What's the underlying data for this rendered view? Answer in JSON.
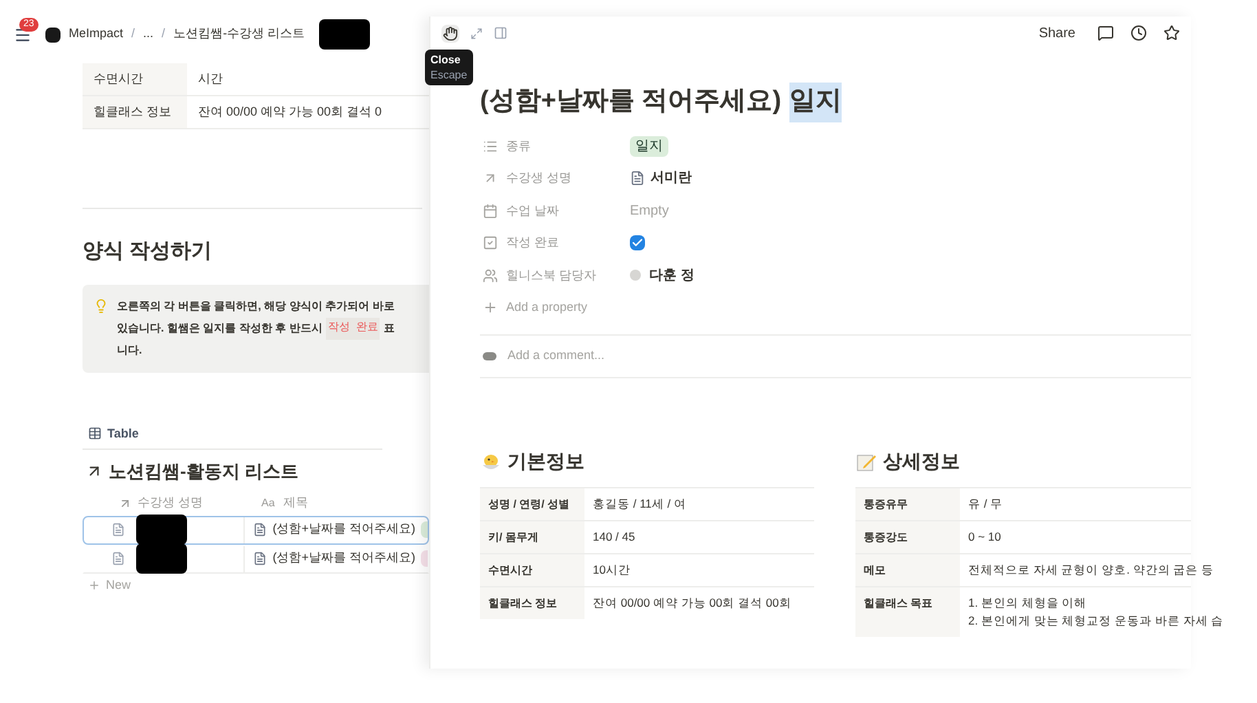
{
  "top_bar": {
    "notification_count": "23",
    "breadcrumbs": [
      "MeImpact",
      "...",
      "노션킴쌤-수강생 리스트"
    ],
    "separator": "/"
  },
  "background_page": {
    "info_table": [
      {
        "label": "수면시간",
        "value": "시간"
      },
      {
        "label": "힐클래스 정보",
        "value": "잔여 00/00  예약 가능 00회  결석 0"
      }
    ],
    "section_title": "양식 작성하기",
    "callout": {
      "line_1": "오른쪽의 각 버튼을 클릭하면, 해당 양식이 추가되어 바로",
      "line_2": "있습니다. 힐쌤은 일지를 작성한 후 반드시",
      "code": "작성 완료",
      "line_2_end": "표",
      "line_3": "니다."
    },
    "view_tab": "Table",
    "database_title": "노션킴쌤-활동지 리스트",
    "columns": [
      {
        "label": "수강생 성명"
      },
      {
        "prefix": "Aa",
        "label": "제목"
      }
    ],
    "rows": [
      {
        "title": "(성함+날짜를 적어주세요)",
        "selected": true,
        "color": "#dbeddb"
      },
      {
        "title": "(성함+날짜를 적어주세요)",
        "selected": false,
        "color": "#f5e0e9"
      }
    ],
    "new_row": "New"
  },
  "panel": {
    "tooltip": {
      "title": "Close",
      "shortcut": "Escape"
    },
    "share": "Share",
    "title": "(성함+날짜를 적어주세요)",
    "title_highlight": "일지",
    "properties": [
      {
        "kind": "select",
        "label": "종류",
        "value": "일지"
      },
      {
        "kind": "relation",
        "label": "수강생 성명",
        "value": "서미란"
      },
      {
        "kind": "date",
        "label": "수업 날짜",
        "value": "Empty"
      },
      {
        "kind": "checkbox",
        "label": "작성 완료",
        "checked": true
      },
      {
        "kind": "person",
        "label": "힐니스북 담당자",
        "value": "다훈 정"
      }
    ],
    "add_property": "Add a property",
    "comment_placeholder": "Add a comment...",
    "sections": [
      {
        "kind": "chick",
        "title": "기본정보",
        "rows": [
          {
            "label": "성명 / 연령/ 성별",
            "lines": [
              "홍길동 / 11세 / 여"
            ]
          },
          {
            "label": "키/ 몸무게",
            "lines": [
              "140 / 45"
            ]
          },
          {
            "label": "수면시간",
            "lines": [
              "10시간"
            ]
          },
          {
            "label": "힐클래스 정보",
            "lines": [
              "잔여 00/00  예약 가능 00회  결석 00회"
            ]
          }
        ]
      },
      {
        "kind": "memo",
        "title": "상세정보",
        "rows": [
          {
            "label": "통증유무",
            "lines": [
              "유 / 무"
            ]
          },
          {
            "label": "통증강도",
            "lines": [
              "0 ~ 10"
            ]
          },
          {
            "label": "메모",
            "lines": [
              "전체적으로 자세 균형이 양호. 약간의 굽은 등"
            ]
          },
          {
            "label": "힐클래스 목표",
            "lines": [
              "1. 본인의 체형을 이해",
              "2. 본인에게 맞는 체형교정 운동과 바른 자세 습"
            ]
          }
        ]
      }
    ]
  }
}
